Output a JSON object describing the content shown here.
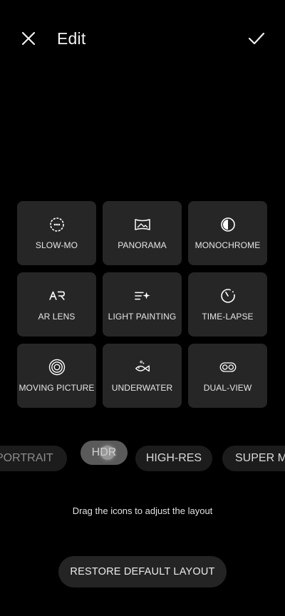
{
  "header": {
    "title": "Edit",
    "close_icon": "close-icon",
    "confirm_icon": "check-icon"
  },
  "modes_grid": [
    {
      "label": "SLOW-MO",
      "icon": "slow-mo-icon"
    },
    {
      "label": "PANORAMA",
      "icon": "panorama-icon"
    },
    {
      "label": "MONOCHROME",
      "icon": "monochrome-icon"
    },
    {
      "label": "AR LENS",
      "icon": "ar-lens-icon"
    },
    {
      "label": "LIGHT PAINTING",
      "icon": "light-painting-icon"
    },
    {
      "label": "TIME-LAPSE",
      "icon": "time-lapse-icon"
    },
    {
      "label": "MOVING PICTURE",
      "icon": "moving-picture-icon"
    },
    {
      "label": "UNDERWATER",
      "icon": "underwater-icon"
    },
    {
      "label": "DUAL-VIEW",
      "icon": "dual-view-icon"
    }
  ],
  "mode_strip": [
    {
      "label": "PORTRAIT"
    },
    {
      "label": "HDR"
    },
    {
      "label": "HIGH-RES"
    },
    {
      "label": "SUPER MA"
    }
  ],
  "hint": "Drag the icons to adjust the layout",
  "restore_label": "RESTORE DEFAULT LAYOUT"
}
